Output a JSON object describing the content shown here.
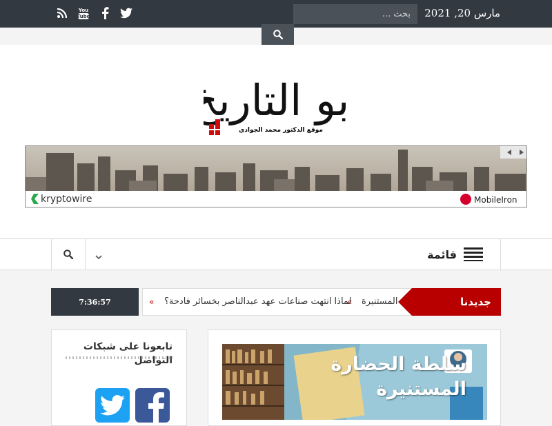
{
  "topbar": {
    "date": "مارس 20, 2021",
    "search_placeholder": "بحث ...",
    "social_icons": [
      "rss-icon",
      "youtube-icon",
      "facebook-icon",
      "twitter-icon"
    ]
  },
  "logo": {
    "title": "أبو التاريخ",
    "subtitle": "موقع الدكتور محمد الجوادي"
  },
  "banner": {
    "left_brand": "kryptowire",
    "right_brand": "MobileIron"
  },
  "nav": {
    "menu_label": "قائمة"
  },
  "ticker": {
    "label": "جديدنا",
    "items": [
      "لماذا انتهت صناعات عهد عبدالناصر بخسائر فادحة؟",
      "المستنيرة"
    ],
    "clock": "7:36:57"
  },
  "sidebar": {
    "title": "تابعونا على شبكات التواصل"
  },
  "article": {
    "title_line1": "سلطة الحضارة",
    "title_line2": "المستنيرة"
  },
  "colors": {
    "topbar": "#333940",
    "accent": "#b90000",
    "facebook": "#3b5998",
    "twitter": "#1da1f2"
  }
}
